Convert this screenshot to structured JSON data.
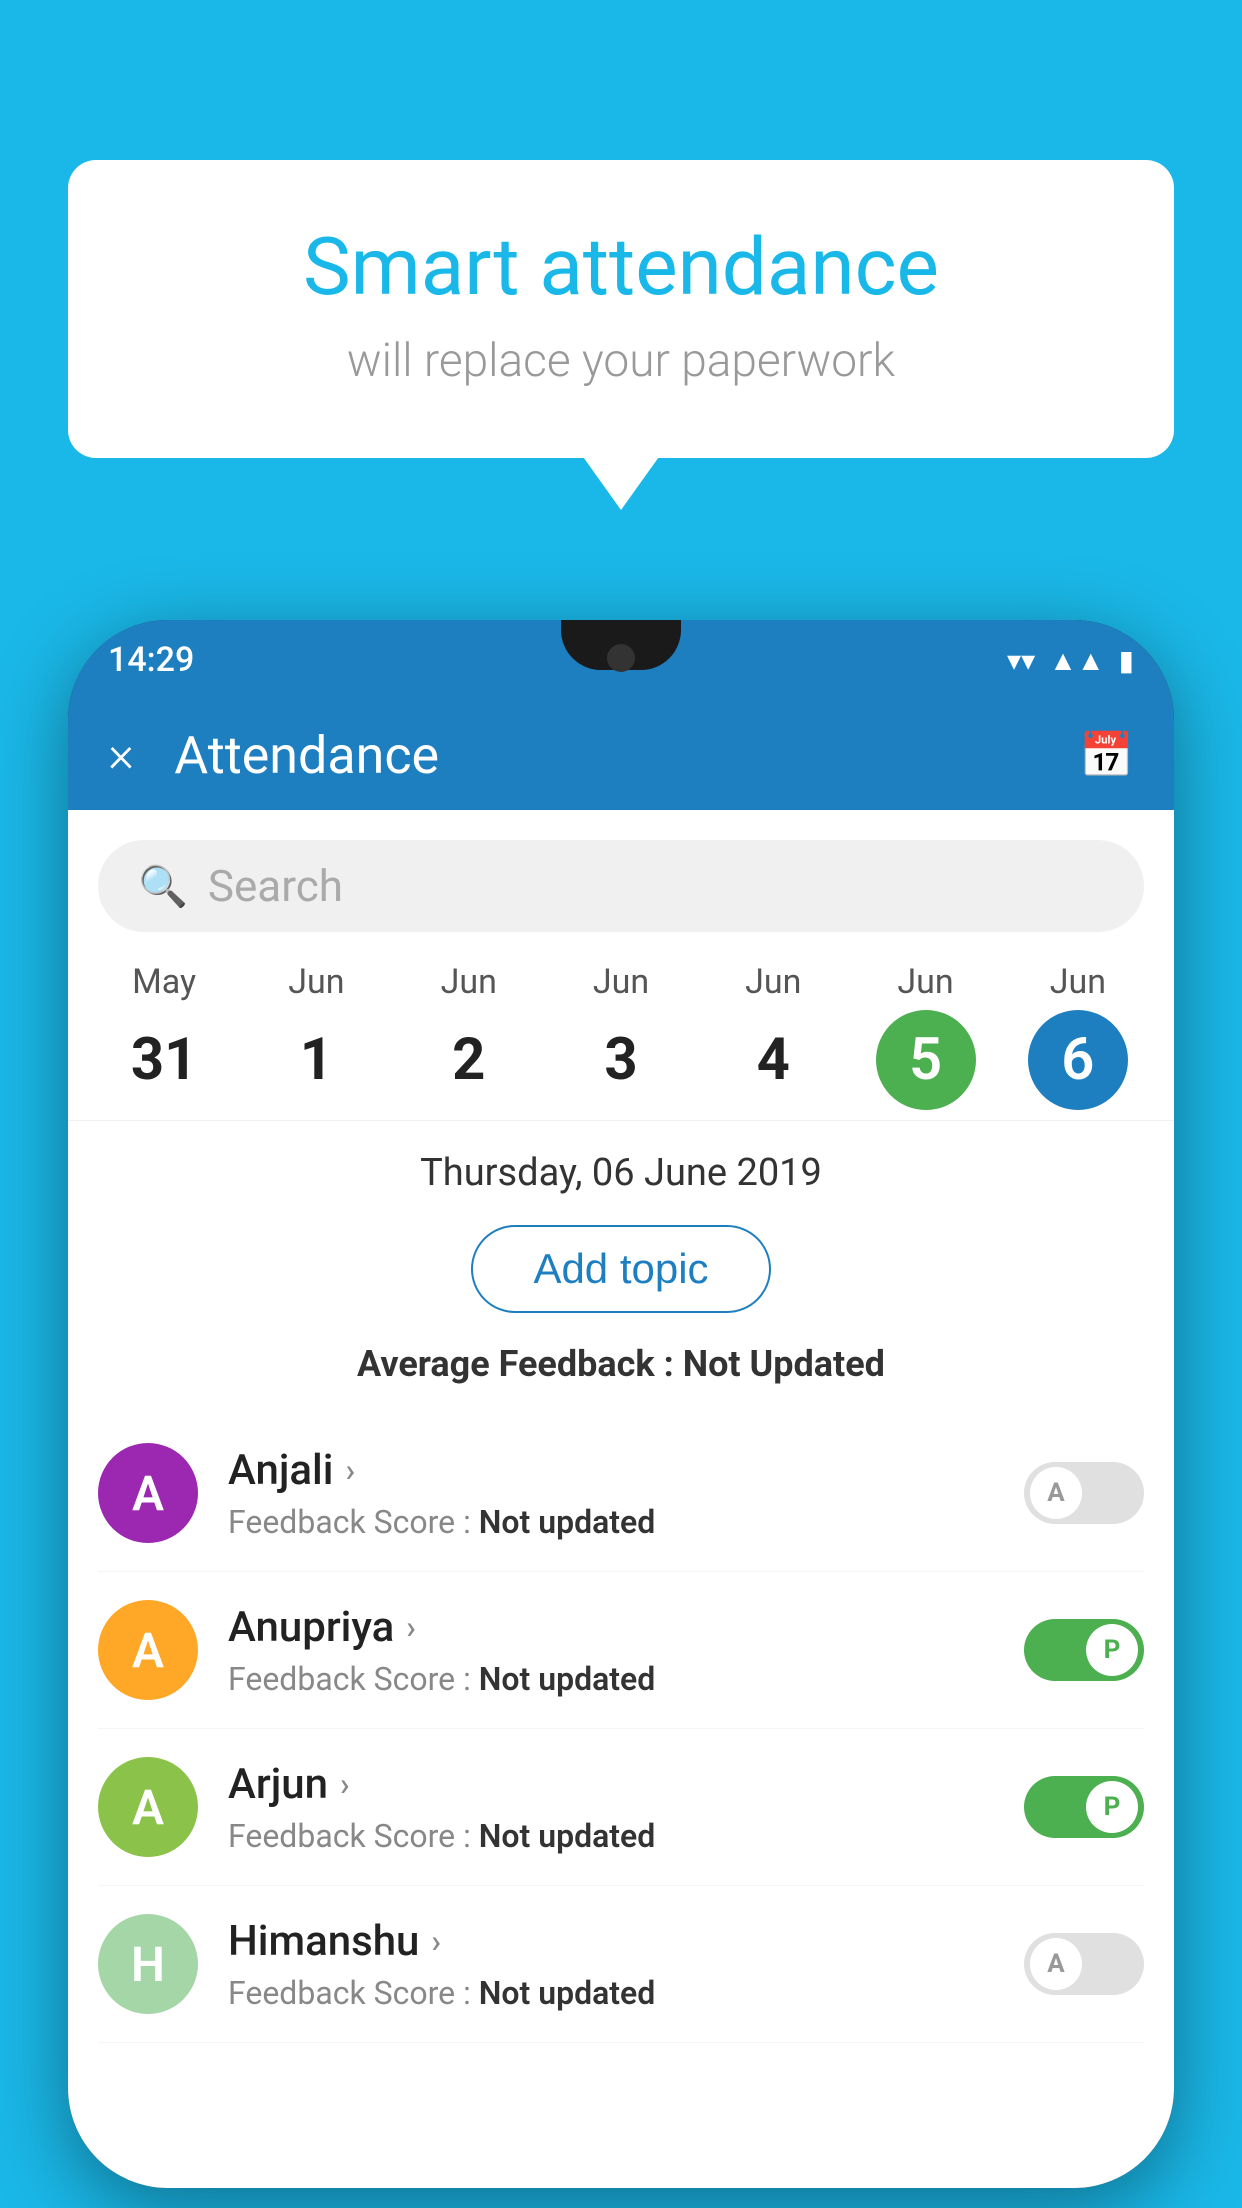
{
  "background_color": "#1ab8e8",
  "speech_bubble": {
    "title": "Smart attendance",
    "subtitle": "will replace your paperwork"
  },
  "status_bar": {
    "time": "14:29",
    "icons": [
      "wifi",
      "signal",
      "battery"
    ]
  },
  "app_bar": {
    "close_label": "×",
    "title": "Attendance",
    "calendar_icon": "📅"
  },
  "search": {
    "placeholder": "Search"
  },
  "calendar": {
    "days": [
      {
        "month": "May",
        "date": "31",
        "style": "normal"
      },
      {
        "month": "Jun",
        "date": "1",
        "style": "normal"
      },
      {
        "month": "Jun",
        "date": "2",
        "style": "normal"
      },
      {
        "month": "Jun",
        "date": "3",
        "style": "normal"
      },
      {
        "month": "Jun",
        "date": "4",
        "style": "normal"
      },
      {
        "month": "Jun",
        "date": "5",
        "style": "green"
      },
      {
        "month": "Jun",
        "date": "6",
        "style": "blue"
      }
    ],
    "selected_date": "Thursday, 06 June 2019"
  },
  "add_topic_label": "Add topic",
  "average_feedback": {
    "label": "Average Feedback : ",
    "value": "Not Updated"
  },
  "students": [
    {
      "name": "Anjali",
      "avatar_letter": "A",
      "avatar_color": "#9c27b0",
      "feedback": "Not updated",
      "toggle": "absent",
      "toggle_letter": "A"
    },
    {
      "name": "Anupriya",
      "avatar_letter": "A",
      "avatar_color": "#ffa726",
      "feedback": "Not updated",
      "toggle": "present",
      "toggle_letter": "P"
    },
    {
      "name": "Arjun",
      "avatar_letter": "A",
      "avatar_color": "#8bc34a",
      "feedback": "Not updated",
      "toggle": "present",
      "toggle_letter": "P"
    },
    {
      "name": "Himanshu",
      "avatar_letter": "H",
      "avatar_color": "#a5d6a7",
      "feedback": "Not updated",
      "toggle": "absent",
      "toggle_letter": "A"
    }
  ],
  "feedback_label": "Feedback Score : "
}
